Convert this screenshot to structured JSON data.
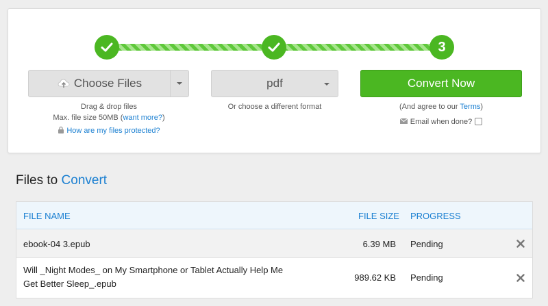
{
  "steps": [
    {
      "state": "done",
      "label": ""
    },
    {
      "state": "done",
      "label": ""
    },
    {
      "state": "current",
      "label": "3"
    }
  ],
  "choose_files": {
    "button_label": "Choose Files",
    "hint_line1": "Drag & drop files",
    "hint_line2_prefix": "Max. file size 50MB (",
    "want_more_link": "want more?",
    "hint_line2_suffix": ")",
    "protected_link": "How are my files protected?"
  },
  "format": {
    "selected": "pdf",
    "hint": "Or choose a different format"
  },
  "convert": {
    "button_label": "Convert Now",
    "agree_prefix": "(And agree to our ",
    "terms_link": "Terms",
    "agree_suffix": ")",
    "email_label": "Email when done?",
    "email_checked": false
  },
  "files_section": {
    "title_part1": "Files to ",
    "title_part2": "Convert"
  },
  "table": {
    "headers": {
      "file_name": "FILE NAME",
      "file_size": "FILE SIZE",
      "progress": "PROGRESS"
    },
    "rows": [
      {
        "file_name_line1": "ebook-04 3.epub",
        "file_name_line2": "",
        "file_size": "6.39 MB",
        "progress": "Pending"
      },
      {
        "file_name_line1": "Will _Night Modes_ on My Smartphone or Tablet Actually Help Me",
        "file_name_line2": "Get Better Sleep_.epub",
        "file_size": "989.62 KB",
        "progress": "Pending"
      }
    ]
  },
  "colors": {
    "accent_green": "#4bb722",
    "link_blue": "#1a7fd1",
    "button_gray": "#e2e2e2"
  }
}
